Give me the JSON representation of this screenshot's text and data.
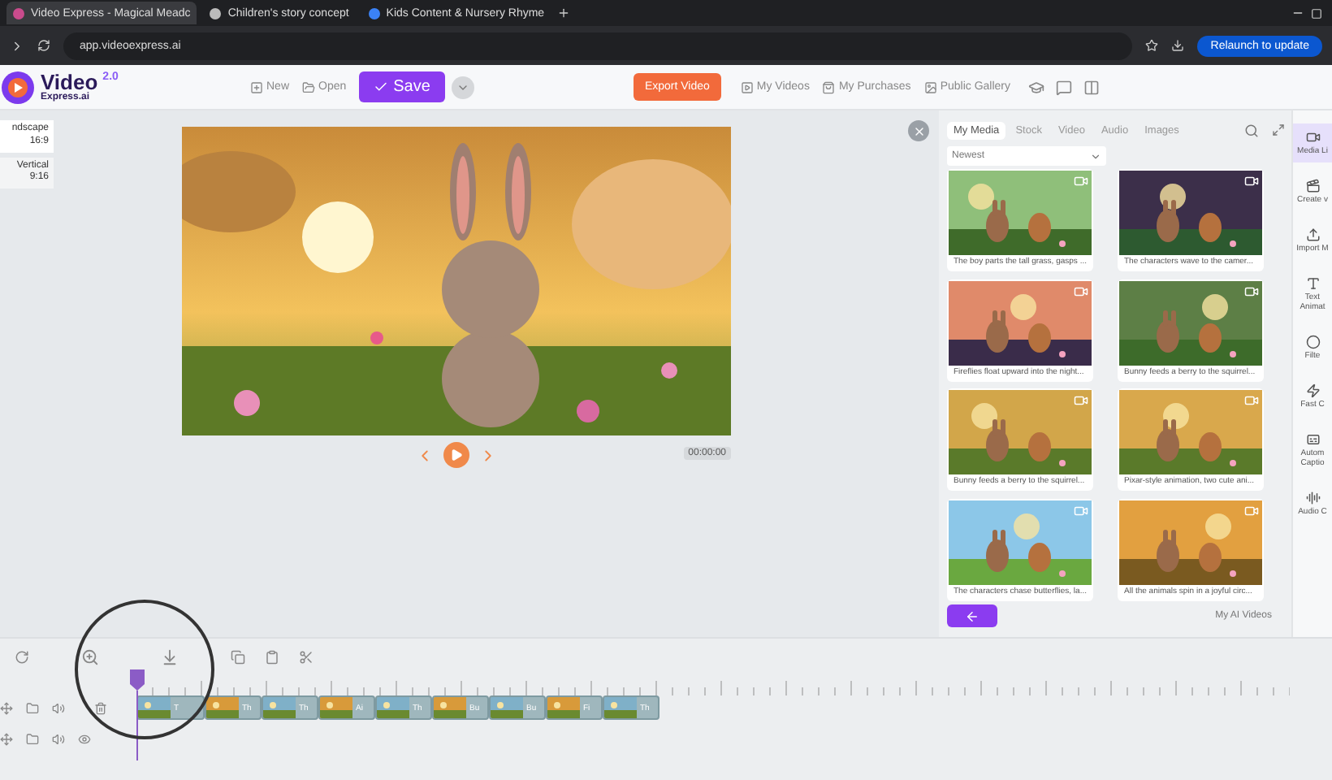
{
  "browser": {
    "tabs": [
      {
        "title": "Video Express - Magical Meadc",
        "selected": true
      },
      {
        "title": "Children's story concept",
        "selected": false
      },
      {
        "title": "Kids Content & Nursery Rhyme",
        "selected": false
      }
    ],
    "url": "app.videoexpress.ai",
    "update_button": "Relaunch to update"
  },
  "header": {
    "logo": {
      "name": "Video",
      "sub": "Express.ai",
      "version": "2.0"
    },
    "actions": [
      "New",
      "Open"
    ],
    "save": "Save",
    "export": "Export Video",
    "links": [
      "My Videos",
      "My Purchases",
      "Public Gallery"
    ]
  },
  "aspect_options": [
    {
      "label": "ndscape",
      "ratio": "16:9",
      "selected": true
    },
    {
      "label": "Vertical",
      "ratio": "9:16",
      "selected": false
    }
  ],
  "preview": {
    "time": "00:00:00"
  },
  "media_panel": {
    "tabs": [
      {
        "label": "My Media",
        "selected": true
      },
      {
        "label": "Stock",
        "selected": false
      },
      {
        "label": "Video",
        "selected": false
      },
      {
        "label": "Audio",
        "selected": false
      },
      {
        "label": "Images",
        "selected": false
      }
    ],
    "sort": "Newest",
    "items": [
      {
        "caption": "The boy parts the tall grass, gasps ..."
      },
      {
        "caption": "The characters wave to the camer..."
      },
      {
        "caption": "Fireflies float upward into the night..."
      },
      {
        "caption": "Bunny feeds a berry to the squirrel..."
      },
      {
        "caption": "Bunny feeds a berry to the squirrel..."
      },
      {
        "caption": "Pixar-style animation, two cute ani..."
      },
      {
        "caption": "The characters chase butterflies, la..."
      },
      {
        "caption": "All the animals spin in a joyful circ..."
      }
    ],
    "footer_link": "My AI Videos"
  },
  "sidebar": [
    {
      "label": "Media Li",
      "selected": true
    },
    {
      "label": "Create v",
      "selected": false
    },
    {
      "label": "Import M",
      "selected": false
    },
    {
      "label": "Text Animat",
      "selected": false
    },
    {
      "label": "Filte",
      "selected": false
    },
    {
      "label": "Fast C",
      "selected": false
    },
    {
      "label": "Autom Captio",
      "selected": false
    },
    {
      "label": "Audio C",
      "selected": false
    }
  ],
  "timeline": {
    "clips": [
      "T",
      "Th",
      "Th",
      "Ai",
      "Th",
      "Bu",
      "Bu",
      "Fi",
      "Th"
    ]
  }
}
